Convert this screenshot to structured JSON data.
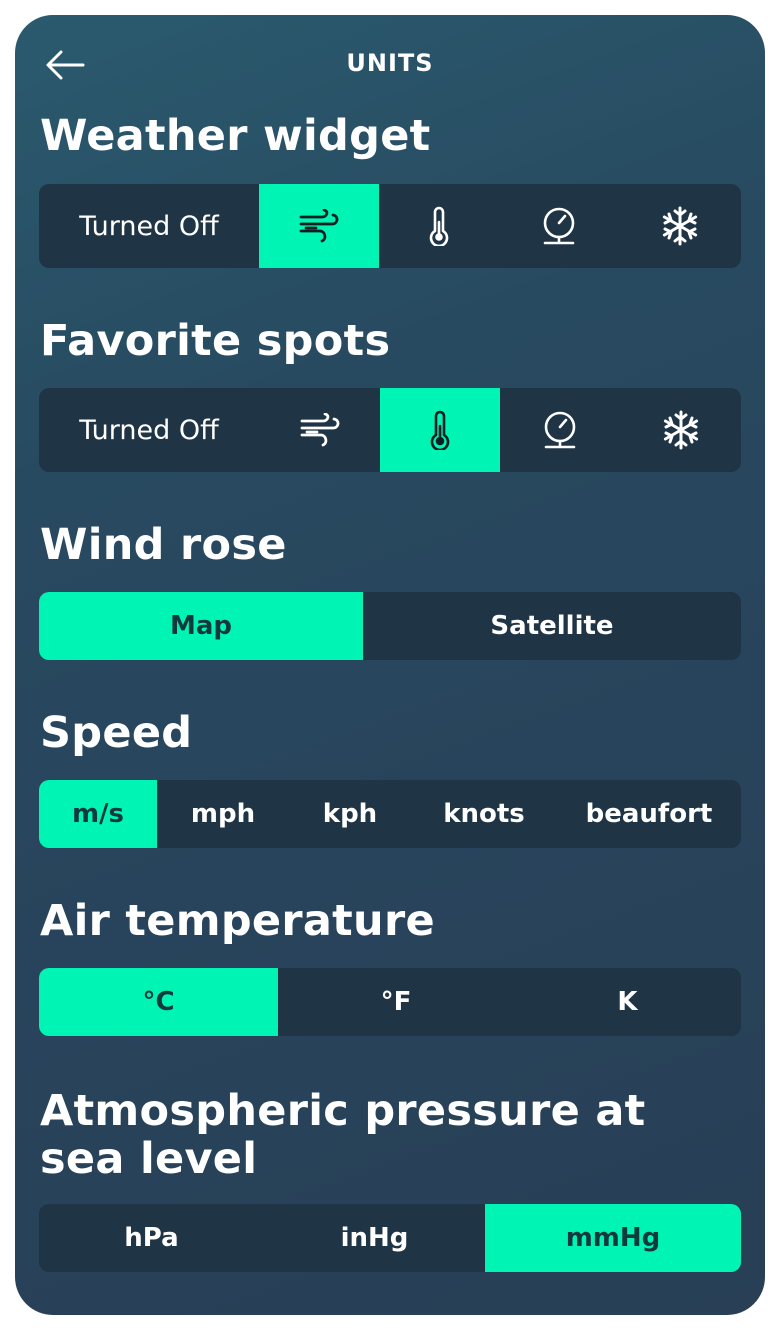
{
  "header": {
    "title": "UNITS",
    "back_icon": "arrow-left-icon"
  },
  "weather_widget": {
    "title": "Weather widget",
    "options": [
      "Turned Off",
      "wind-icon",
      "thermometer-icon",
      "pressure-gauge-icon",
      "snowflake-icon"
    ],
    "turned_off_label": "Turned Off",
    "selected": "wind-icon"
  },
  "favorite_spots": {
    "title": "Favorite spots",
    "options": [
      "Turned Off",
      "wind-icon",
      "thermometer-icon",
      "pressure-gauge-icon",
      "snowflake-icon"
    ],
    "turned_off_label": "Turned Off",
    "selected": "thermometer-icon"
  },
  "wind_rose": {
    "title": "Wind rose",
    "options": [
      "Map",
      "Satellite"
    ],
    "selected": "Map"
  },
  "speed": {
    "title": "Speed",
    "options": [
      "m/s",
      "mph",
      "kph",
      "knots",
      "beaufort"
    ],
    "selected": "m/s"
  },
  "air_temperature": {
    "title": "Air temperature",
    "options": [
      "°C",
      "°F",
      "K"
    ],
    "selected": "°C"
  },
  "pressure": {
    "title": "Atmospheric pressure at sea level",
    "options": [
      "hPa",
      "inHg",
      "mmHg"
    ],
    "selected": "mmHg"
  },
  "colors": {
    "accent": "#00f5b4",
    "segment_bg": "#1f3445",
    "card_bg": "#284a60"
  }
}
